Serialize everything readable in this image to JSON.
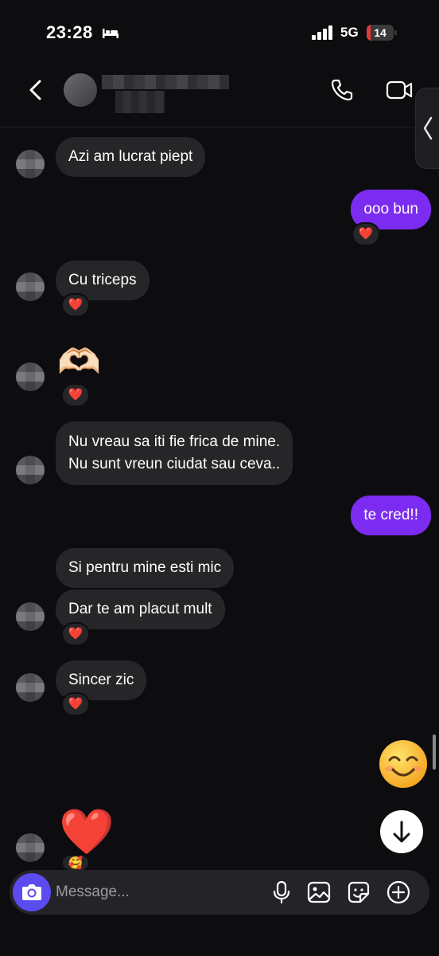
{
  "status_bar": {
    "time": "23:28",
    "network": "5G",
    "battery": "14",
    "battery_level": 0.14
  },
  "header": {
    "back_icon": "chevron-left-icon",
    "call_icon": "phone-icon",
    "video_icon": "video-camera-icon"
  },
  "messages": {
    "m1": {
      "text": "Azi am lucrat piept"
    },
    "m2": {
      "text": "ooo bun",
      "reaction": "❤️"
    },
    "m3": {
      "text": "Cu triceps",
      "reaction": "❤️"
    },
    "m4": {
      "emoji": "🫶🏻",
      "reaction": "❤️"
    },
    "m5": {
      "line1": "Nu vreau sa iti fie frica de mine.",
      "line2": "Nu sunt vreun ciudat sau ceva.."
    },
    "m6": {
      "text": "te cred!!"
    },
    "m7": {
      "text": "Si pentru mine esti mic"
    },
    "m8": {
      "text": "Dar te am placut mult",
      "reaction": "❤️"
    },
    "m9": {
      "text": "Sincer zic",
      "reaction": "❤️"
    },
    "m10": {
      "emoji": "❤️",
      "reaction": "🥰"
    }
  },
  "composer": {
    "placeholder": "Message...",
    "icons": [
      "camera-icon",
      "microphone-icon",
      "gallery-icon",
      "sticker-icon",
      "plus-icon"
    ]
  },
  "colors": {
    "background": "#0d0d10",
    "incoming_bubble": "#262629",
    "outgoing_bubble": "#7b2cf0",
    "camera_button": "#5b4bf0"
  }
}
